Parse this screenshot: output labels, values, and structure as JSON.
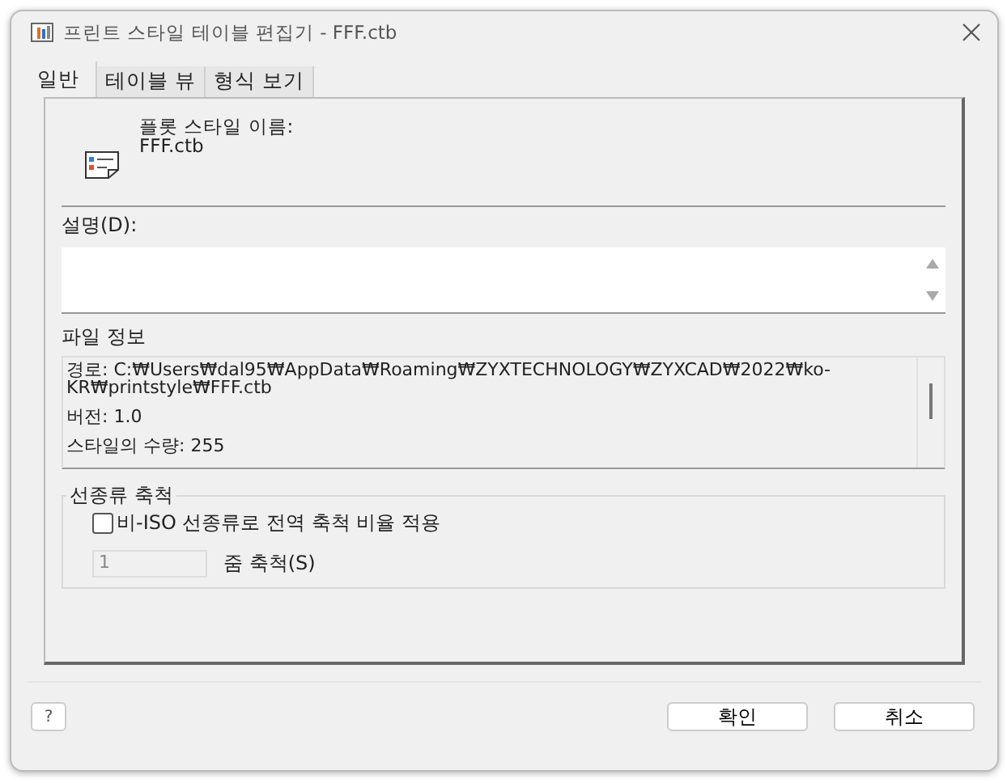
{
  "window": {
    "title": "프린트 스타일 테이블 편집기 - FFF.ctb"
  },
  "tabs": [
    {
      "label": "일반",
      "selected": true
    },
    {
      "label": "테이블 뷰",
      "selected": false
    },
    {
      "label": "형식 보기",
      "selected": false
    }
  ],
  "plot_style": {
    "label": "플롯 스타일 이름:",
    "name": "FFF.ctb"
  },
  "description": {
    "label": "설명(D):"
  },
  "file_info": {
    "label": "파일 정보",
    "lines": [
      "경로: C:₩Users₩dal95₩AppData₩Roaming₩ZYXTECHNOLOGY₩ZYXCAD₩2022₩ko-KR₩printstyle₩FFF.ctb",
      "버전: 1.0",
      "스타일의 수량: 255"
    ]
  },
  "linetype_scale": {
    "label": "선종류 축척",
    "checkbox": {
      "label": "비-ISO 선종류로 전역 축척 비율 적용",
      "checked": false
    },
    "zoom_value": "1",
    "zoom_label": "줌 축척(S)"
  },
  "help": "?",
  "buttons": [
    "확인",
    "취소"
  ]
}
